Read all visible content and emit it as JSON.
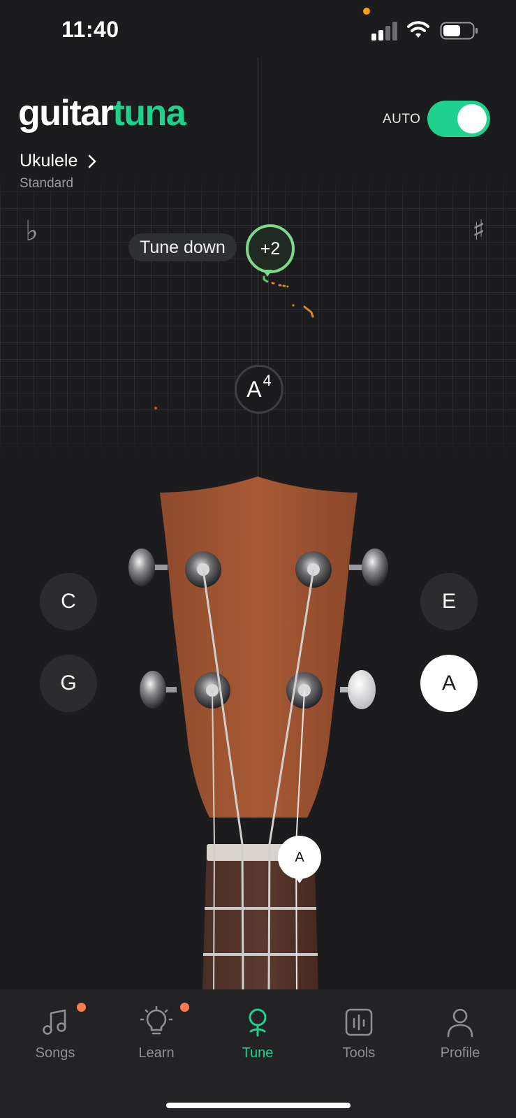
{
  "status_bar": {
    "time": "11:40",
    "icons": [
      "signal-icon",
      "wifi-icon",
      "battery-icon"
    ]
  },
  "header": {
    "logo_part1": "guitar",
    "logo_part2": "tuna",
    "auto_label": "AUTO",
    "auto_enabled": true,
    "instrument": "Ukulele",
    "tuning": "Standard"
  },
  "tuner": {
    "flat_symbol": "♭",
    "sharp_symbol": "♯",
    "hint": "Tune down",
    "cents": "+2",
    "note": "A",
    "octave": "4"
  },
  "strings": {
    "c": "C",
    "g": "G",
    "e": "E",
    "a": "A",
    "active": "A",
    "marker": "A"
  },
  "tabs": [
    {
      "label": "Songs",
      "icon": "music-note-icon",
      "badge": true
    },
    {
      "label": "Learn",
      "icon": "lightbulb-icon",
      "badge": true
    },
    {
      "label": "Tune",
      "icon": "tuner-icon",
      "active": true
    },
    {
      "label": "Tools",
      "icon": "tools-icon"
    },
    {
      "label": "Profile",
      "icon": "profile-icon"
    }
  ],
  "colors": {
    "accent": "#1ed18c",
    "in_tune": "#7ed889",
    "badge": "#ff7b4d",
    "background": "#1c1c1e"
  }
}
